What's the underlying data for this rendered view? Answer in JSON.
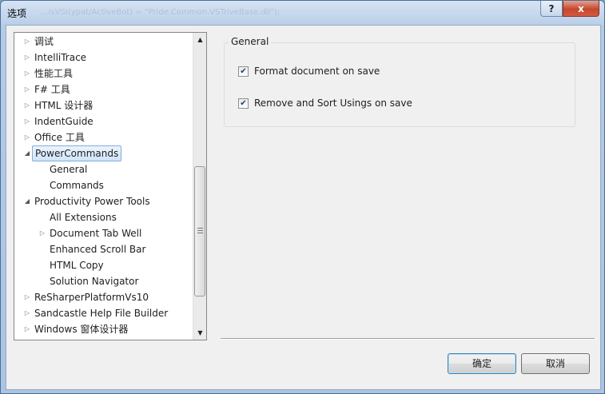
{
  "window": {
    "title": "选项",
    "background_title": "...IsVSI(ypat/ActiveBot) = \"Pride.Common.VSTriveBase.dll\");",
    "help_label": "?",
    "close_label": "x"
  },
  "tree": {
    "items": [
      {
        "label": "调试",
        "level": 0,
        "expander": "collapsed"
      },
      {
        "label": "IntelliTrace",
        "level": 0,
        "expander": "collapsed"
      },
      {
        "label": "性能工具",
        "level": 0,
        "expander": "collapsed"
      },
      {
        "label": "F# 工具",
        "level": 0,
        "expander": "collapsed"
      },
      {
        "label": "HTML 设计器",
        "level": 0,
        "expander": "collapsed"
      },
      {
        "label": "IndentGuide",
        "level": 0,
        "expander": "collapsed"
      },
      {
        "label": "Office 工具",
        "level": 0,
        "expander": "collapsed"
      },
      {
        "label": "PowerCommands",
        "level": 0,
        "expander": "expanded",
        "selected": true
      },
      {
        "label": "General",
        "level": 1,
        "expander": "none"
      },
      {
        "label": "Commands",
        "level": 1,
        "expander": "none"
      },
      {
        "label": "Productivity Power Tools",
        "level": 0,
        "expander": "expanded"
      },
      {
        "label": "All Extensions",
        "level": 1,
        "expander": "none"
      },
      {
        "label": "Document Tab Well",
        "level": 1,
        "expander": "collapsed"
      },
      {
        "label": "Enhanced Scroll Bar",
        "level": 1,
        "expander": "none"
      },
      {
        "label": "HTML Copy",
        "level": 1,
        "expander": "none"
      },
      {
        "label": "Solution Navigator",
        "level": 1,
        "expander": "none"
      },
      {
        "label": "ReSharperPlatformVs10",
        "level": 0,
        "expander": "collapsed"
      },
      {
        "label": "Sandcastle Help File Builder",
        "level": 0,
        "expander": "collapsed"
      },
      {
        "label": "Windows 窗体设计器",
        "level": 0,
        "expander": "collapsed"
      }
    ],
    "scroll_position": 0.55
  },
  "settings": {
    "group_title": "General",
    "options": [
      {
        "label": "Format document on save",
        "checked": true
      },
      {
        "label": "Remove and Sort Usings on save",
        "checked": true
      }
    ]
  },
  "buttons": {
    "ok_label": "确定",
    "cancel_label": "取消"
  },
  "colors": {
    "selection_border": "#84acdd",
    "close_button": "#c6472f"
  }
}
